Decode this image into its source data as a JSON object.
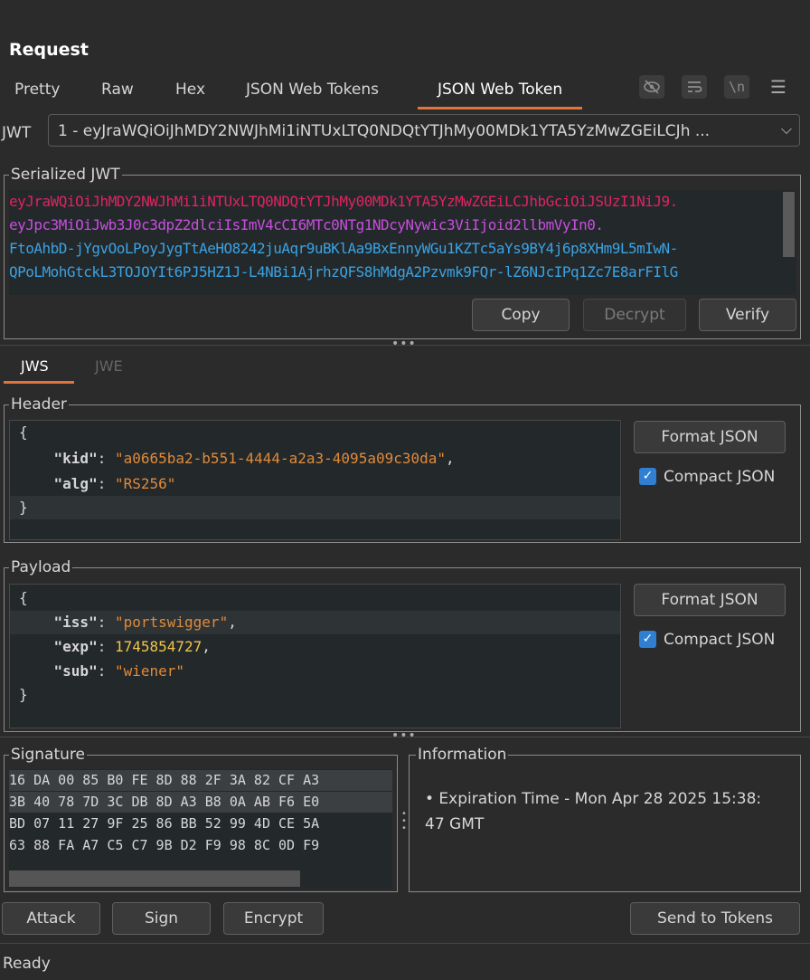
{
  "title": "Request",
  "tabs": [
    "Pretty",
    "Raw",
    "Hex",
    "JSON Web Tokens",
    "JSON Web Token"
  ],
  "toolbar_icons": [
    "eye-off-icon",
    "wrap-icon",
    "newline-icon",
    "menu-icon"
  ],
  "toolbar_glyphs": {
    "newline": "\\n",
    "menu": "☰"
  },
  "jwt": {
    "label": "JWT",
    "selected": "1 - eyJraWQiOiJhMDY2NWJhMi1iNTUxLTQ0NDQtYTJhMy00MDk1YTA5YzMwZGEiLCJh ...",
    "chevron": "⌵"
  },
  "serialized": {
    "title": "Serialized JWT",
    "lines": [
      {
        "text": "eyJraWQiOiJhMDY2NWJhMi1iNTUxLTQ0NDQtYTJhMy00MDk1YTA5YzMwZGEiLCJhbGciOiJSUzI1NiJ9.",
        "color": "#e0245e"
      },
      {
        "text": "eyJpc3MiOiJwb3J0c3dpZ2dlciIsImV4cCI6MTc0NTg1NDcyNywic3ViIjoid2llbmVyIn0.",
        "color": "#c94ee0"
      },
      {
        "text": "FtoAhbD-jYgvOoLPoyJygTtAeHO8242juAqr9uBKlAa9BxEnnyWGu1KZTc5aYs9BY4j6p8XHm9L5mIwN-",
        "color": "#3aa3e3"
      },
      {
        "text": "QPoLMohGtckL3TOJOYIt6PJ5HZ1J-L4NBi1AjrhzQFS8hMdgA2Pzvmk9FQr-lZ6NJcIPq1Zc7E8arFIlG",
        "color": "#3aa3e3"
      }
    ],
    "buttons": {
      "copy": "Copy",
      "decrypt": "Decrypt",
      "verify": "Verify"
    }
  },
  "mode_tabs": {
    "jws": "JWS",
    "jwe": "JWE"
  },
  "header": {
    "title": "Header",
    "open": "{",
    "close": "}",
    "kid_key": "\"kid\"",
    "kid_value": "\"a0665ba2-b551-4444-a2a3-4095a09c30da\"",
    "alg_key": "\"alg\"",
    "alg_value": "\"RS256\"",
    "format_button": "Format JSON",
    "compact_label": "Compact JSON",
    "compact_checked": true
  },
  "payload": {
    "title": "Payload",
    "open": "{",
    "close": "}",
    "iss_key": "\"iss\"",
    "iss_value": "\"portswigger\"",
    "exp_key": "\"exp\"",
    "exp_value": "1745854727",
    "sub_key": "\"sub\"",
    "sub_value": "\"wiener\"",
    "format_button": "Format JSON",
    "compact_label": "Compact JSON",
    "compact_checked": true
  },
  "signature": {
    "title": "Signature",
    "rows": [
      "16 DA 00 85 B0 FE 8D 88 2F 3A 82 CF A3",
      "3B 40 78 7D 3C DB 8D A3 B8 0A AB F6 E0",
      "BD 07 11 27 9F 25 86 BB 52 99 4D CE 5A",
      "63 88 FA A7 C5 C7 9B D2 F9 98 8C 0D F9"
    ]
  },
  "information": {
    "title": "Information",
    "items": [
      "• Expiration Time - Mon Apr 28 2025 15:38:",
      "47 GMT"
    ]
  },
  "actions": {
    "attack": "Attack",
    "sign": "Sign",
    "encrypt": "Encrypt",
    "send": "Send to Tokens"
  },
  "status": "Ready",
  "colors": {
    "accent": "#e2733b",
    "checkbox": "#2f7fd3",
    "string": "#e08a3a",
    "number": "#f0c64a"
  }
}
